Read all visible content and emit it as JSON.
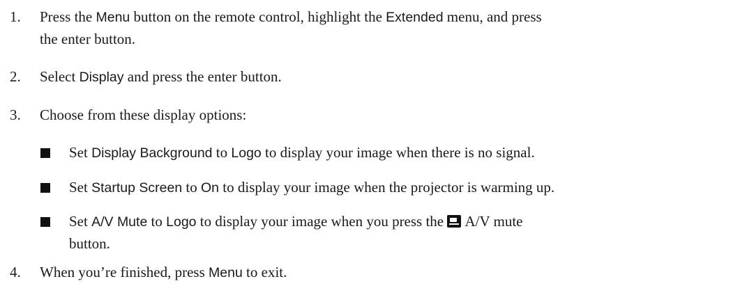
{
  "steps": [
    {
      "number": "1.",
      "p1": "Press the ",
      "b1": "Menu",
      "p2": " button on the remote control, highlight the ",
      "b2": "Extended",
      "p3": " menu, and press",
      "p4": "the enter button."
    },
    {
      "number": "2.",
      "p1": "Select ",
      "b1": "Display",
      "p2": " and press the enter button."
    },
    {
      "number": "3.",
      "p1": "Choose from these display options:"
    },
    {
      "number": "4.",
      "p1": "When you’re finished, press ",
      "b1": "Menu",
      "p2": " to exit."
    }
  ],
  "options": [
    {
      "p1": "Set ",
      "b1": "Display Background",
      "p2": " to ",
      "b2": "Logo",
      "p3": " to display your image when there is no signal."
    },
    {
      "p1": "Set ",
      "b1": "Startup Screen",
      "p2": " to ",
      "b2": "On",
      "p3": " to display your image when the projector is warming up."
    },
    {
      "p1": "Set ",
      "b1": "A/V Mute",
      "p2": " to ",
      "b2": "Logo",
      "p3": " to display your image when you press the ",
      "p4": " A/V mute",
      "p5": "button.",
      "icon": "av-mute-icon"
    }
  ]
}
